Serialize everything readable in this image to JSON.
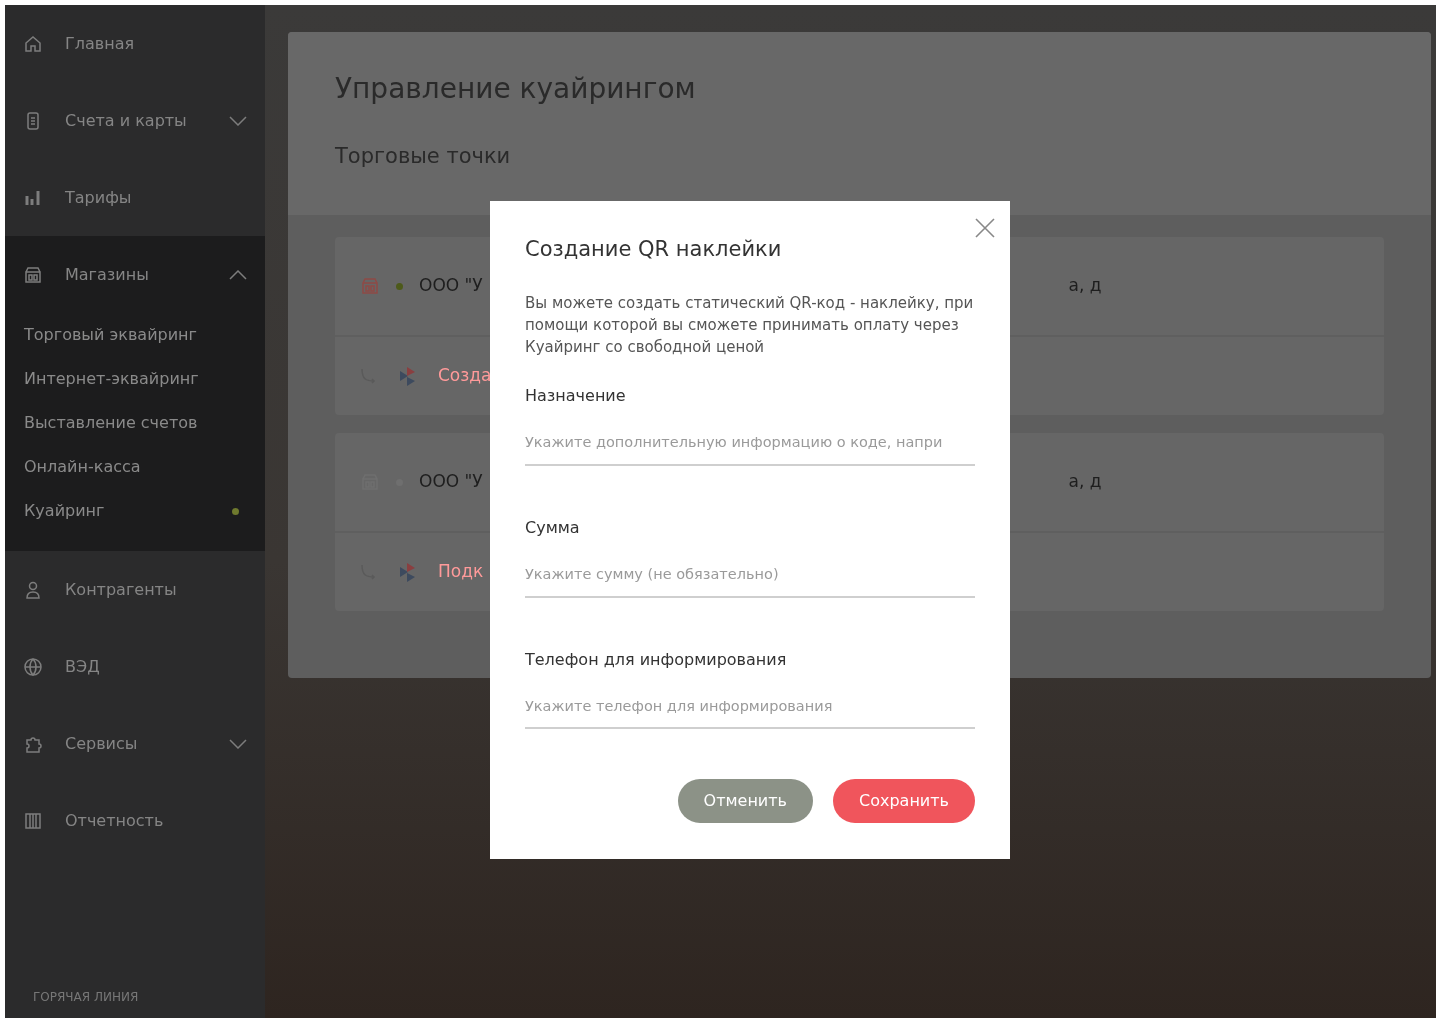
{
  "sidebar": {
    "items": [
      {
        "label": "Главная"
      },
      {
        "label": "Счета и карты",
        "expanded": false
      },
      {
        "label": "Тарифы"
      },
      {
        "label": "Магазины",
        "expanded": true,
        "children": [
          {
            "label": "Торговый эквайринг",
            "selected": false
          },
          {
            "label": "Интернет-эквайринг",
            "selected": false
          },
          {
            "label": "Выставление счетов",
            "selected": false
          },
          {
            "label": "Онлайн-касса",
            "selected": false
          },
          {
            "label": "Куайринг",
            "selected": true
          }
        ]
      },
      {
        "label": "Контрагенты"
      },
      {
        "label": "ВЭД"
      },
      {
        "label": "Сервисы",
        "expanded": false
      },
      {
        "label": "Отчетность"
      }
    ],
    "hotline": "ГОРЯЧАЯ ЛИНИЯ"
  },
  "page": {
    "title": "Управление куайрингом",
    "section": "Торговые точки",
    "stores": [
      {
        "name": "ООО \"У",
        "address": "а, д",
        "active": true,
        "action": "Созда"
      },
      {
        "name": "ООО \"У",
        "address": "а, д",
        "active": false,
        "action": "Подк"
      }
    ]
  },
  "modal": {
    "title": "Создание QR наклейки",
    "description": "Вы можете создать статический QR-код - наклейку, при помощи которой вы сможете принимать оплату через Куайринг со свободной ценой",
    "fields": [
      {
        "label": "Назначение",
        "placeholder": "Укажите дополнительную информацию о коде, напри"
      },
      {
        "label": "Сумма",
        "placeholder": "Укажите сумму (не обязательно)"
      },
      {
        "label": "Телефон для информирования",
        "placeholder": "Укажите телефон для информирования"
      }
    ],
    "buttons": [
      {
        "label": "Отменить",
        "kind": "secondary"
      },
      {
        "label": "Сохранить",
        "kind": "primary"
      }
    ]
  }
}
